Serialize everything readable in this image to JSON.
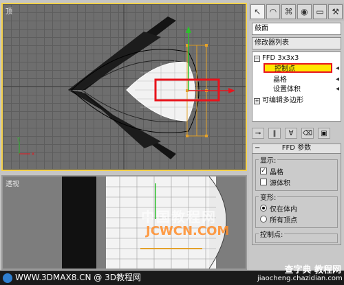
{
  "viewports": {
    "top": {
      "label": "顶"
    },
    "perspective": {
      "label": "透视"
    }
  },
  "panel": {
    "tabs": [
      "pointer-icon",
      "arc-icon",
      "hierarchy-icon",
      "motion-icon",
      "display-icon",
      "utility-icon"
    ],
    "object_name": "鼓面",
    "modifier_list": "修改器列表",
    "stack": [
      {
        "label": "FFD 3x3x3",
        "icon": "minus-box-icon"
      },
      {
        "label": "控制点",
        "highlighted": true
      },
      {
        "label": "晶格"
      },
      {
        "label": "设置体积"
      },
      {
        "label": "可编辑多边形",
        "icon": "plus-box-icon"
      }
    ],
    "rollout": {
      "title": "FFD 参数",
      "display_group": "显示:",
      "lattice_label": "晶格",
      "lattice_checked": true,
      "source_volume_label": "源体积",
      "source_volume_checked": false,
      "deform_group": "变形:",
      "inside_volume_label": "仅在体内",
      "all_vertices_label": "所有顶点",
      "control_points_group": "控制点:"
    }
  },
  "watermark": {
    "line1": "中国教程网",
    "line2": "JCWCN.COM"
  },
  "status": {
    "text": "WWW.3DMAX8.CN @ 3D教程网"
  },
  "badge": {
    "title": "查字典 教程网",
    "url": "jiaocheng.chazidian.com"
  },
  "colors": {
    "highlight": "#ffe800",
    "red_box": "#e8141c",
    "viewport_active_border": "#f6d24a"
  }
}
